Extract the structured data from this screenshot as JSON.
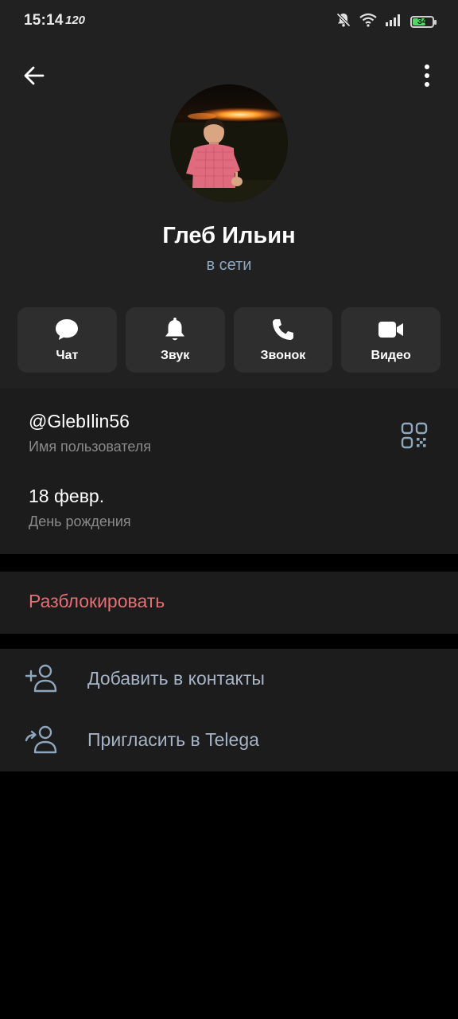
{
  "status_bar": {
    "time": "15:14",
    "refresh_rate": "120",
    "battery": "34"
  },
  "profile": {
    "name": "Глеб Ильин",
    "status": "в сети"
  },
  "actions": [
    {
      "label": "Чат",
      "icon": "chat-icon"
    },
    {
      "label": "Звук",
      "icon": "bell-icon"
    },
    {
      "label": "Звонок",
      "icon": "phone-icon"
    },
    {
      "label": "Видео",
      "icon": "video-icon"
    }
  ],
  "info": {
    "username": "@GlebIlin56",
    "username_label": "Имя пользователя",
    "birthday": "18 февр.",
    "birthday_label": "День рождения"
  },
  "unblock": {
    "label": "Разблокировать"
  },
  "contacts": {
    "add_label": "Добавить в контакты",
    "invite_label": "Пригласить в Telega"
  },
  "colors": {
    "header_bg": "#212121",
    "section_bg": "#1c1c1c",
    "status_text": "#8fa7be",
    "danger": "#e56f74",
    "link": "#a6b3c6"
  }
}
